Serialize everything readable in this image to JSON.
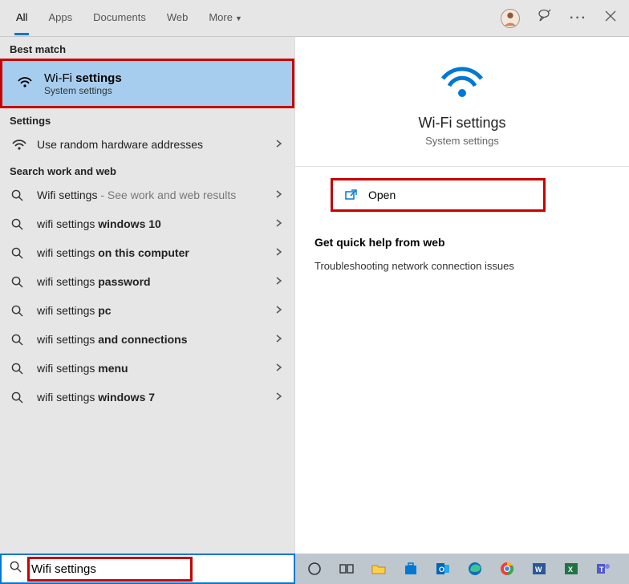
{
  "tabs": [
    "All",
    "Apps",
    "Documents",
    "Web",
    "More"
  ],
  "active_tab": 0,
  "sections": {
    "best_match_label": "Best match",
    "settings_label": "Settings",
    "search_web_label": "Search work and web"
  },
  "best_match": {
    "title_plain": "Wi-Fi ",
    "title_bold": "settings",
    "subtitle": "System settings"
  },
  "settings_items": [
    {
      "label": "Use random hardware addresses"
    }
  ],
  "search_suggestions": [
    {
      "plain": "Wifi settings",
      "bold": "",
      "tail": " - See work and web results"
    },
    {
      "plain": "wifi settings ",
      "bold": "windows 10",
      "tail": ""
    },
    {
      "plain": "wifi settings ",
      "bold": "on this computer",
      "tail": ""
    },
    {
      "plain": "wifi settings ",
      "bold": "password",
      "tail": ""
    },
    {
      "plain": "wifi settings ",
      "bold": "pc",
      "tail": ""
    },
    {
      "plain": "wifi settings ",
      "bold": "and connections",
      "tail": ""
    },
    {
      "plain": "wifi settings ",
      "bold": "menu",
      "tail": ""
    },
    {
      "plain": "wifi settings ",
      "bold": "windows 7",
      "tail": ""
    }
  ],
  "detail": {
    "title": "Wi-Fi settings",
    "subtitle": "System settings",
    "open_label": "Open",
    "help_header": "Get quick help from web",
    "help_link": "Troubleshooting network connection issues"
  },
  "search_input": {
    "value": "Wifi settings"
  },
  "taskbar_apps": [
    "cortana",
    "task-view",
    "file-explorer",
    "store",
    "outlook",
    "edge",
    "chrome",
    "word",
    "excel",
    "teams"
  ]
}
